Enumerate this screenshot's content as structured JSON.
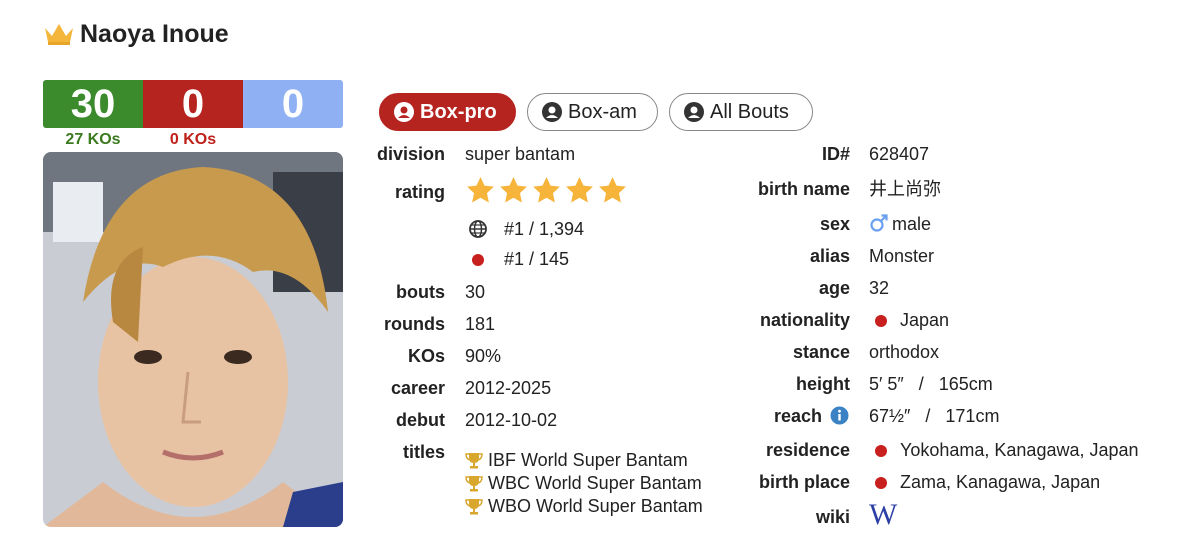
{
  "header": {
    "name": "Naoya Inoue"
  },
  "record": {
    "wins": "30",
    "losses": "0",
    "draws": "0",
    "win_kos": "27 KOs",
    "loss_kos": "0 KOs"
  },
  "tabs": [
    {
      "label": "Box-pro",
      "active": true
    },
    {
      "label": "Box-am",
      "active": false
    },
    {
      "label": "All Bouts",
      "active": false
    }
  ],
  "left_info": {
    "division_label": "division",
    "division": "super bantam",
    "rating_label": "rating",
    "rating_stars": 5,
    "world_rank": "#1 / 1,394",
    "country_rank": "#1 / 145",
    "bouts_label": "bouts",
    "bouts": "30",
    "rounds_label": "rounds",
    "rounds": "181",
    "kos_label": "KOs",
    "kos": "90%",
    "career_label": "career",
    "career": "2012-2025",
    "debut_label": "debut",
    "debut": "2012-10-02",
    "titles_label": "titles",
    "titles": [
      "IBF World Super Bantam",
      "WBC World Super Bantam",
      "WBO World Super Bantam"
    ]
  },
  "right_info": {
    "id_label": "ID#",
    "id": "628407",
    "birth_name_label": "birth name",
    "birth_name": "井上尚弥",
    "sex_label": "sex",
    "sex": "male",
    "alias_label": "alias",
    "alias": "Monster",
    "age_label": "age",
    "age": "32",
    "nationality_label": "nationality",
    "nationality": "Japan",
    "stance_label": "stance",
    "stance": "orthodox",
    "height_label": "height",
    "height": "5′ 5″   /   165cm",
    "reach_label": "reach",
    "reach": "67½″   /   171cm",
    "residence_label": "residence",
    "residence": "Yokohama, Kanagawa, Japan",
    "birth_place_label": "birth place",
    "birth_place": "Zama, Kanagawa, Japan",
    "wiki_label": "wiki",
    "wiki_glyph": "W"
  },
  "colors": {
    "win": "#3b8a2c",
    "loss": "#b5241f",
    "draw": "#8fb0f2",
    "star": "#f6b43b",
    "flag_dot": "#c8201e",
    "info": "#3b82c4"
  }
}
